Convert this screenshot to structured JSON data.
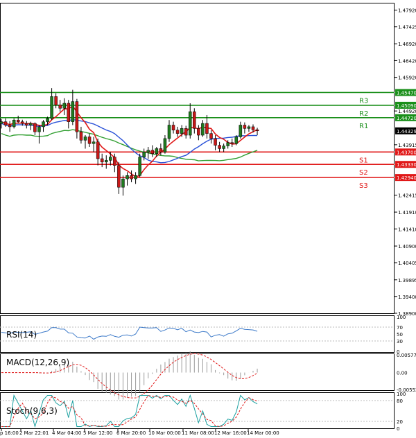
{
  "chart_data": {
    "type": "candlestick",
    "symbol": "",
    "price_axis": {
      "ticks": [
        "1.47920",
        "1.47425",
        "1.46920",
        "1.46420",
        "1.45920",
        "1.45470",
        "1.45090",
        "1.44920",
        "1.44720",
        "1.44329",
        "1.43915",
        "1.43700",
        "1.43330",
        "1.42940",
        "1.42415",
        "1.41910",
        "1.41410",
        "1.40900",
        "1.40405",
        "1.39895",
        "1.39400",
        "1.38900"
      ],
      "range": [
        1.389,
        1.4812
      ]
    },
    "time_axis": {
      "ticks": [
        "p 16:00",
        "2 Mar 22:01",
        "4 Mar 04:00",
        "5 Mar 12:00",
        "6 Mar 20:00",
        "10 Mar 00:00",
        "11 Mar 08:00",
        "12 Mar 16:00",
        "14 Mar 00:00"
      ]
    },
    "levels": [
      {
        "label": "R3",
        "value": 1.4547,
        "price_label": "1.45470",
        "color": "#1a8f1a"
      },
      {
        "label": "R2",
        "value": 1.4509,
        "price_label": "1.45090",
        "color": "#1a8f1a"
      },
      {
        "label": "R1",
        "value": 1.4472,
        "price_label": "1.44720",
        "color": "#1a8f1a"
      },
      {
        "label": "S1",
        "value": 1.437,
        "price_label": "1.43700",
        "color": "#e01818"
      },
      {
        "label": "S2",
        "value": 1.4333,
        "price_label": "1.43330",
        "color": "#e01818"
      },
      {
        "label": "S3",
        "value": 1.4294,
        "price_label": "1.42940",
        "color": "#e01818"
      }
    ],
    "current_price": {
      "value": 1.44329,
      "label": "1.44329"
    },
    "candles": [
      [
        1.4455,
        1.4468,
        1.444,
        1.446
      ],
      [
        1.446,
        1.447,
        1.4445,
        1.445
      ],
      [
        1.445,
        1.4462,
        1.443,
        1.4445
      ],
      [
        1.4445,
        1.447,
        1.444,
        1.4465
      ],
      [
        1.4465,
        1.4478,
        1.4455,
        1.446
      ],
      [
        1.446,
        1.4466,
        1.4448,
        1.4455
      ],
      [
        1.4455,
        1.4462,
        1.444,
        1.445
      ],
      [
        1.445,
        1.446,
        1.4435,
        1.4455
      ],
      [
        1.4455,
        1.4458,
        1.442,
        1.443
      ],
      [
        1.443,
        1.445,
        1.4395,
        1.4445
      ],
      [
        1.4445,
        1.4465,
        1.443,
        1.446
      ],
      [
        1.446,
        1.4475,
        1.445,
        1.447
      ],
      [
        1.447,
        1.456,
        1.4465,
        1.4535
      ],
      [
        1.4535,
        1.4545,
        1.45,
        1.451
      ],
      [
        1.451,
        1.4525,
        1.449,
        1.45
      ],
      [
        1.45,
        1.453,
        1.448,
        1.4515
      ],
      [
        1.4515,
        1.4525,
        1.444,
        1.446
      ],
      [
        1.446,
        1.4555,
        1.445,
        1.452
      ],
      [
        1.452,
        1.4528,
        1.441,
        1.443
      ],
      [
        1.443,
        1.4445,
        1.4395,
        1.4405
      ],
      [
        1.4405,
        1.442,
        1.438,
        1.4415
      ],
      [
        1.4415,
        1.4425,
        1.4385,
        1.4395
      ],
      [
        1.4395,
        1.4415,
        1.437,
        1.44
      ],
      [
        1.44,
        1.441,
        1.433,
        1.435
      ],
      [
        1.435,
        1.4365,
        1.4325,
        1.434
      ],
      [
        1.434,
        1.436,
        1.432,
        1.4345
      ],
      [
        1.4345,
        1.437,
        1.433,
        1.4355
      ],
      [
        1.4355,
        1.4365,
        1.431,
        1.433
      ],
      [
        1.433,
        1.434,
        1.4245,
        1.4265
      ],
      [
        1.4265,
        1.43,
        1.424,
        1.429
      ],
      [
        1.429,
        1.431,
        1.427,
        1.43
      ],
      [
        1.43,
        1.4315,
        1.428,
        1.429
      ],
      [
        1.429,
        1.431,
        1.4275,
        1.43
      ],
      [
        1.43,
        1.4365,
        1.4295,
        1.4355
      ],
      [
        1.4355,
        1.438,
        1.4345,
        1.437
      ],
      [
        1.437,
        1.4385,
        1.435,
        1.4375
      ],
      [
        1.4375,
        1.439,
        1.4355,
        1.4365
      ],
      [
        1.4365,
        1.4385,
        1.4355,
        1.438
      ],
      [
        1.438,
        1.4395,
        1.436,
        1.437
      ],
      [
        1.437,
        1.442,
        1.4365,
        1.441
      ],
      [
        1.441,
        1.4465,
        1.44,
        1.445
      ],
      [
        1.445,
        1.446,
        1.4425,
        1.4435
      ],
      [
        1.4435,
        1.4445,
        1.4415,
        1.4425
      ],
      [
        1.4425,
        1.445,
        1.4415,
        1.444
      ],
      [
        1.444,
        1.4448,
        1.441,
        1.442
      ],
      [
        1.442,
        1.4515,
        1.441,
        1.449
      ],
      [
        1.449,
        1.45,
        1.4425,
        1.444
      ],
      [
        1.444,
        1.445,
        1.4405,
        1.442
      ],
      [
        1.442,
        1.4465,
        1.4415,
        1.4455
      ],
      [
        1.4455,
        1.448,
        1.441,
        1.4425
      ],
      [
        1.4425,
        1.4435,
        1.4395,
        1.441
      ],
      [
        1.441,
        1.442,
        1.4375,
        1.439
      ],
      [
        1.439,
        1.44,
        1.437,
        1.438
      ],
      [
        1.438,
        1.4395,
        1.437,
        1.4388
      ],
      [
        1.4388,
        1.4405,
        1.438,
        1.4398
      ],
      [
        1.4398,
        1.441,
        1.4385,
        1.4395
      ],
      [
        1.4395,
        1.442,
        1.439,
        1.4415
      ],
      [
        1.4415,
        1.446,
        1.441,
        1.445
      ],
      [
        1.445,
        1.4458,
        1.4425,
        1.444
      ],
      [
        1.444,
        1.445,
        1.443,
        1.4445
      ],
      [
        1.4445,
        1.4452,
        1.4428,
        1.4436
      ],
      [
        1.4436,
        1.4442,
        1.442,
        1.4433
      ]
    ],
    "indicators": {
      "rsi": {
        "label": "RSI(14)",
        "range": [
          0,
          100
        ],
        "ticks": [
          "100",
          "70",
          "50",
          "30",
          "0"
        ],
        "color": "#3a78c8"
      },
      "macd": {
        "label": "MACD(12,26,9)",
        "range": [
          -0.00552,
          0.005774
        ],
        "ticks": [
          "0.005774",
          "0.00",
          "-0.00552"
        ],
        "hist_color": "#9a9a9a",
        "signal_color": "#e01818"
      },
      "stoch": {
        "label": "Stoch(9,6,3)",
        "range": [
          0,
          100
        ],
        "ticks": [
          "100",
          "80",
          "20",
          "0"
        ],
        "k_color": "#1aa0a0",
        "d_color": "#e01818"
      }
    }
  }
}
